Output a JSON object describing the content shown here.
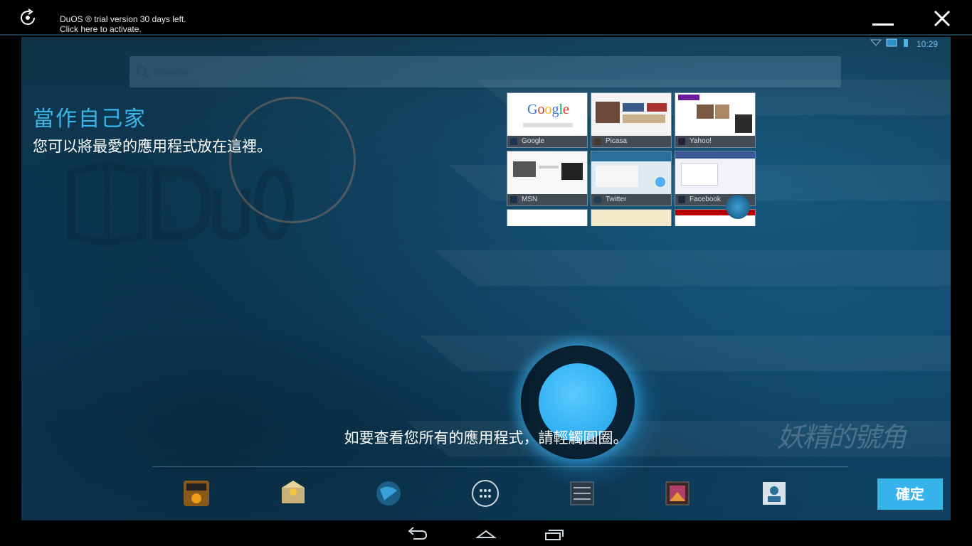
{
  "window": {
    "trial_line1": "DuOS ® trial version 30 days left.",
    "trial_line2": "Click here to activate."
  },
  "status": {
    "time": "10:29"
  },
  "search": {
    "placeholder": "Google"
  },
  "intro": {
    "title": "當作自己家",
    "subtitle": "您可以將最愛的應用程式放在這裡。"
  },
  "thumbnails": [
    {
      "label": "Google",
      "icon_color": "#4285f4"
    },
    {
      "label": "Picasa",
      "icon_color": "#e8a33d"
    },
    {
      "label": "Yahoo!",
      "icon_color": "#6a1b9a"
    },
    {
      "label": "MSN",
      "icon_color": "#2b7bc4"
    },
    {
      "label": "Twitter",
      "icon_color": "#55acee"
    },
    {
      "label": "Facebook",
      "icon_color": "#3b5998"
    }
  ],
  "hint": "如要查看您所有的應用程式，請輕觸圓圈。",
  "watermark": "妖精的號角",
  "dock": [
    "amazon-appstore-icon",
    "email-icon",
    "browser-icon",
    "all-apps-icon",
    "settings-icon",
    "gallery-icon",
    "contacts-icon"
  ],
  "confirm_label": "確定",
  "nav": [
    "back-icon",
    "home-icon",
    "recent-apps-icon"
  ],
  "colors": {
    "accent": "#35b3ea",
    "title": "#38b6ea"
  }
}
